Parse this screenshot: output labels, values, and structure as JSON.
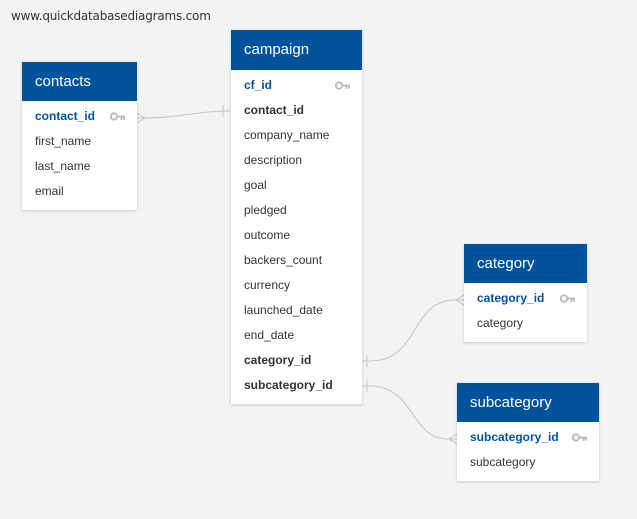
{
  "watermark": "www.quickdatabasediagrams.com",
  "colors": {
    "header": "#00539b",
    "primary_key_text": "#00539b",
    "field_text": "#333333",
    "connector": "#c4c4c4",
    "key_icon": "#b9b9b9",
    "background": "#f2f3f3"
  },
  "tables": {
    "contacts": {
      "title": "contacts",
      "fields": [
        {
          "name": "contact_id",
          "role": "primary-key"
        },
        {
          "name": "first_name",
          "role": "column"
        },
        {
          "name": "last_name",
          "role": "column"
        },
        {
          "name": "email",
          "role": "column"
        }
      ]
    },
    "campaign": {
      "title": "campaign",
      "fields": [
        {
          "name": "cf_id",
          "role": "primary-key"
        },
        {
          "name": "contact_id",
          "role": "foreign-key"
        },
        {
          "name": "company_name",
          "role": "column"
        },
        {
          "name": "description",
          "role": "column"
        },
        {
          "name": "goal",
          "role": "column"
        },
        {
          "name": "pledged",
          "role": "column"
        },
        {
          "name": "outcome",
          "role": "column"
        },
        {
          "name": "backers_count",
          "role": "column"
        },
        {
          "name": "currency",
          "role": "column"
        },
        {
          "name": "launched_date",
          "role": "column"
        },
        {
          "name": "end_date",
          "role": "column"
        },
        {
          "name": "category_id",
          "role": "foreign-key"
        },
        {
          "name": "subcategory_id",
          "role": "foreign-key"
        }
      ]
    },
    "category": {
      "title": "category",
      "fields": [
        {
          "name": "category_id",
          "role": "primary-key"
        },
        {
          "name": "category",
          "role": "column"
        }
      ]
    },
    "subcategory": {
      "title": "subcategory",
      "fields": [
        {
          "name": "subcategory_id",
          "role": "primary-key"
        },
        {
          "name": "subcategory",
          "role": "column"
        }
      ]
    }
  },
  "relationships": [
    {
      "from": "campaign.contact_id",
      "to": "contacts.contact_id",
      "from_end": "one",
      "to_end": "many"
    },
    {
      "from": "campaign.category_id",
      "to": "category.category_id",
      "from_end": "one",
      "to_end": "many"
    },
    {
      "from": "campaign.subcategory_id",
      "to": "subcategory.subcategory_id",
      "from_end": "one",
      "to_end": "many"
    }
  ]
}
